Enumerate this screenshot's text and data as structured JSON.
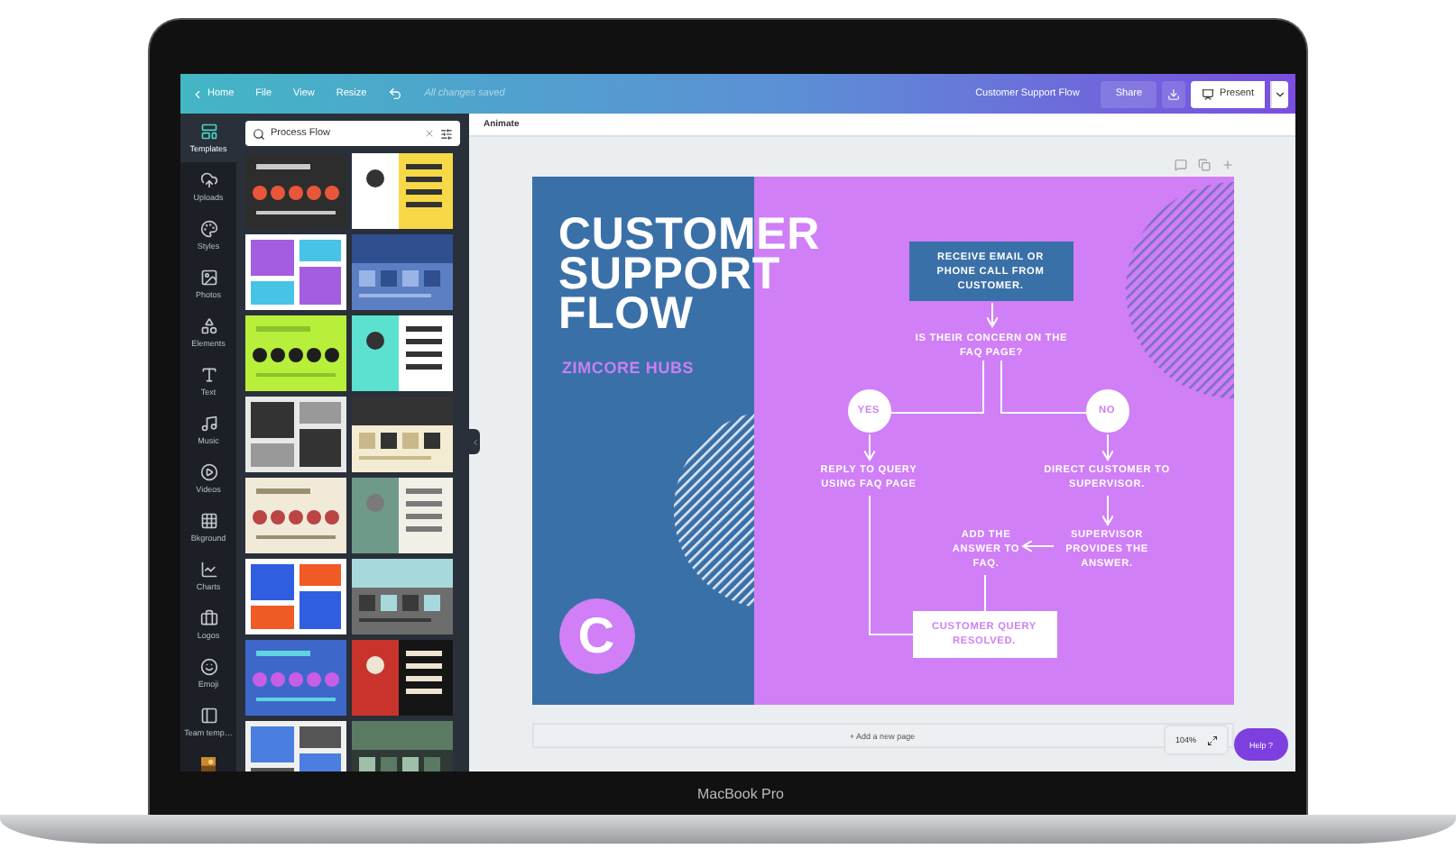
{
  "top_bar": {
    "back": "Home",
    "menus": [
      "File",
      "View",
      "Resize"
    ],
    "save_status": "All changes saved",
    "document_title": "Customer Support Flow",
    "share": "Share",
    "present": "Present"
  },
  "rail": [
    {
      "label": "Templates",
      "selected": true
    },
    {
      "label": "Uploads",
      "selected": false
    },
    {
      "label": "Styles",
      "selected": false
    },
    {
      "label": "Photos",
      "selected": false
    },
    {
      "label": "Elements",
      "selected": false
    },
    {
      "label": "Text",
      "selected": false
    },
    {
      "label": "Music",
      "selected": false
    },
    {
      "label": "Videos",
      "selected": false
    },
    {
      "label": "Bkground",
      "selected": false
    },
    {
      "label": "Charts",
      "selected": false
    },
    {
      "label": "Logos",
      "selected": false
    },
    {
      "label": "Emoji",
      "selected": false
    },
    {
      "label": "Team temp…",
      "selected": false
    }
  ],
  "search": {
    "value": "Process Flow"
  },
  "toolbar": {
    "animate": "Animate"
  },
  "design": {
    "title": "CUSTOMER SUPPORT FLOW",
    "subtitle": "ZIMCORE HUBS",
    "logo_letter": "C",
    "steps": [
      {
        "kind": "box",
        "text": "RECEIVE EMAIL OR PHONE CALL FROM CUSTOMER."
      },
      {
        "kind": "text",
        "text": "IS THEIR CONCERN ON THE FAQ PAGE?"
      },
      {
        "kind": "circle",
        "text": "YES"
      },
      {
        "kind": "circle",
        "text": "NO"
      },
      {
        "kind": "text",
        "text": "REPLY TO QUERY USING FAQ PAGE"
      },
      {
        "kind": "text",
        "text": "DIRECT CUSTOMER TO SUPERVISOR."
      },
      {
        "kind": "text",
        "text": "ADD THE ANSWER TO FAQ."
      },
      {
        "kind": "text",
        "text": "SUPERVISOR PROVIDES THE ANSWER."
      },
      {
        "kind": "resolved",
        "text": "CUSTOMER QUERY RESOLVED."
      }
    ]
  },
  "add_page": "+ Add a new page",
  "zoom": "104%",
  "help": "Help ?",
  "device": {
    "label": "MacBook Pro"
  }
}
